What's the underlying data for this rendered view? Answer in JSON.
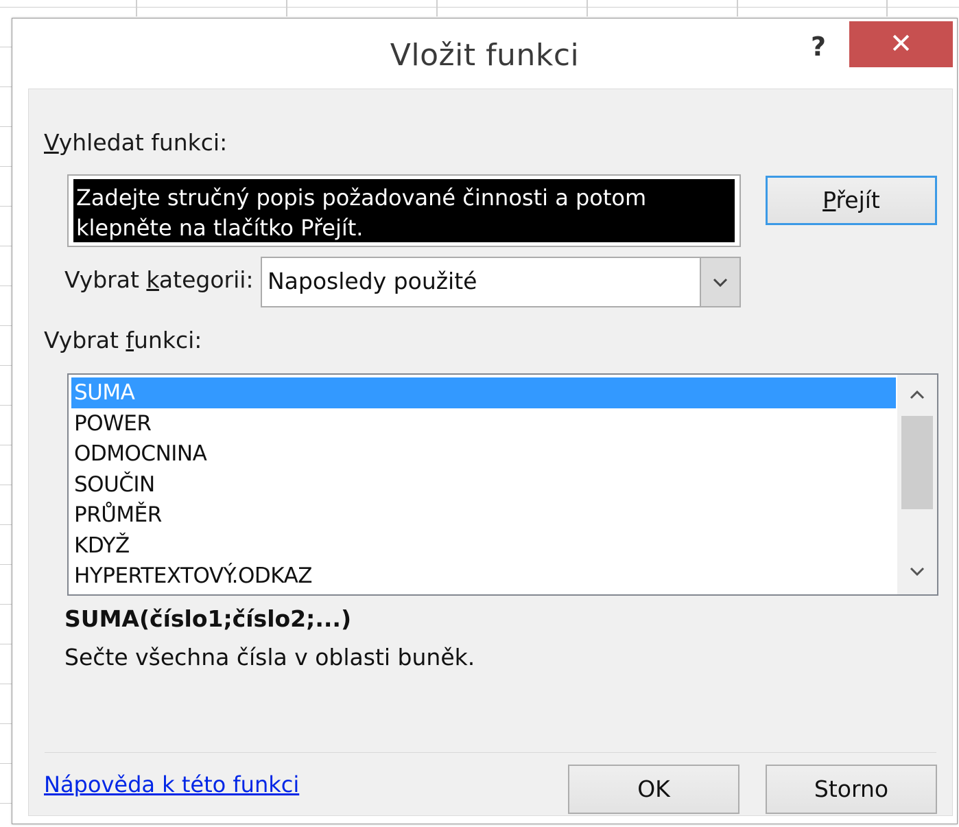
{
  "dialog": {
    "title": "Vložit funkci",
    "help_button": "?",
    "close_button": "✕"
  },
  "search": {
    "label_underlined": "V",
    "label_rest": "yhledat funkci:",
    "text": "Zadejte stručný popis požadované činnosti a potom klepněte na tlačítko Přejít.",
    "go_button_underlined": "P",
    "go_button_rest": "řejít"
  },
  "category": {
    "label_pre": "Vybrat ",
    "label_underlined": "k",
    "label_post": "ategorii:",
    "selected": "Naposledy použité"
  },
  "function_list": {
    "label_pre": "Vybrat ",
    "label_underlined": "f",
    "label_post": "unkci:",
    "items": [
      "SUMA",
      "POWER",
      "ODMOCNINA",
      "SOUČIN",
      "PRŮMĚR",
      "KDYŽ",
      "HYPERTEXTOVÝ.ODKAZ"
    ],
    "selected_index": 0
  },
  "details": {
    "signature": "SUMA(číslo1;číslo2;...)",
    "description": "Sečte všechna čísla v oblasti buněk."
  },
  "footer": {
    "help_link": "Nápověda k této funkci",
    "ok_button": "OK",
    "cancel_button": "Storno"
  },
  "colors": {
    "close_button_bg": "#c75050",
    "selection_bg": "#3399ff",
    "link": "#0026e6",
    "default_button_border": "#3c9ae6"
  }
}
